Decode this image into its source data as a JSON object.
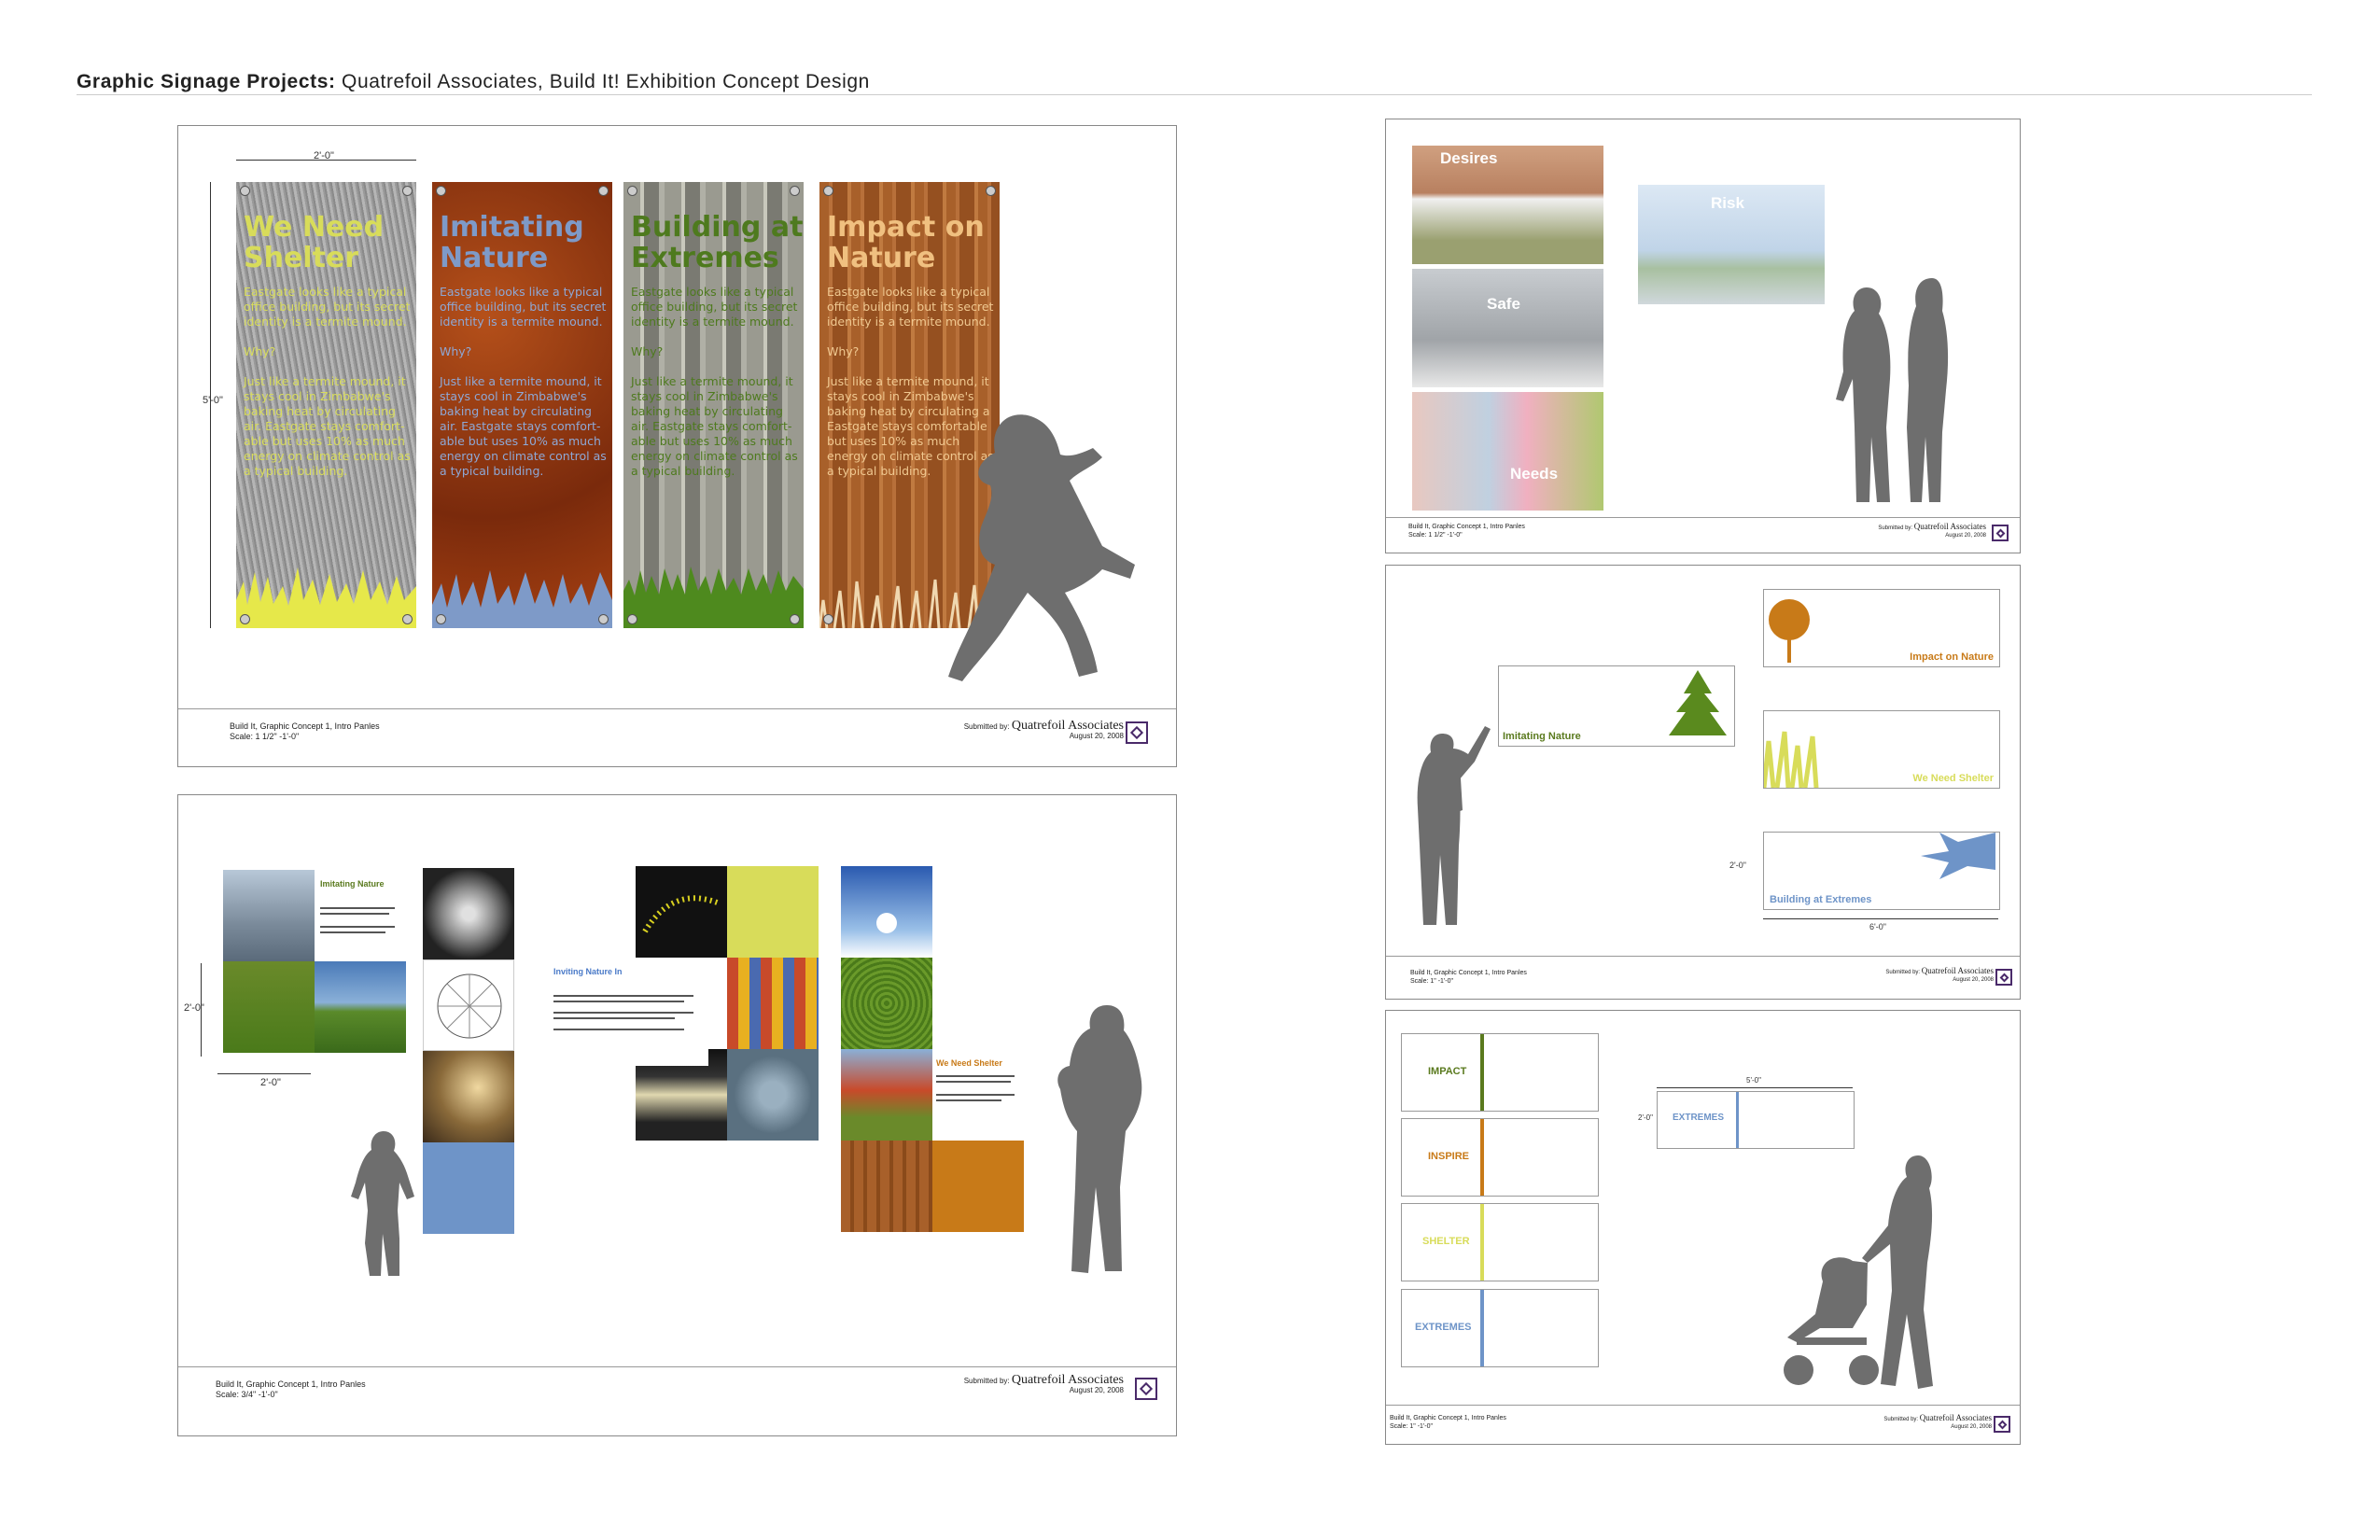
{
  "title": {
    "bold": "Graphic Signage Projects:",
    "rest": " Quatrefoil Associates, Build It! Exhibition Concept Design"
  },
  "colors": {
    "purple": "#4a2a6a",
    "green": "#5a7a1e",
    "orange": "#c87a18",
    "yellow_green": "#d8dc5a",
    "blue": "#6e94c8",
    "silhouette": "#6e6e6e"
  },
  "board1": {
    "dims": {
      "width": "2'-0\"",
      "height": "5'-0\""
    },
    "banners": [
      {
        "title": "We Need\nShelter",
        "color": "#d8dc5a",
        "body": "Eastgate looks like a typical\noffice building, but its secret\nidentity is a termite mound.\n\nWhy?\n\nJust like a termite mound, it\nstays cool in Zimbabwe's\nbaking heat by circulating\nair. Eastgate stays comfort-\nable but uses 10% as much\nenergy on climate control as\na typical building."
      },
      {
        "title": "Imitating\nNature",
        "color": "#7e9ac8",
        "body": "Eastgate looks like a typical\noffice building, but its secret\nidentity is a termite mound.\n\nWhy?\n\nJust like a termite mound, it\nstays cool in Zimbabwe's\nbaking heat by circulating\nair. Eastgate stays comfort-\nable but uses 10% as much\nenergy on climate control as\na typical building."
      },
      {
        "title": "Building at\nExtremes",
        "color": "#4e7a1e",
        "body": "Eastgate looks like a typical\noffice building, but its secret\nidentity is a termite mound.\n\nWhy?\n\nJust like a termite mound, it\nstays cool in Zimbabwe's\nbaking heat by circulating\nair. Eastgate stays comfort-\nable but uses 10% as much\nenergy on climate control as\na typical building."
      },
      {
        "title": "Impact on\nNature",
        "color": "#f0c080",
        "body": "Eastgate looks like a typical\noffice building, but its secret\nidentity is a termite mound.\n\nWhy?\n\nJust like a termite mound, it\nstays cool in Zimbabwe's\nbaking heat by circulating a\nEastgate stays comfortable\nbut uses 10% as much\nenergy on climate control as\na typical building."
      }
    ],
    "footer": {
      "line1": "Build It, Graphic Concept 1, Intro Panles",
      "line2": "Scale: 1 1/2\" -1'-0\"",
      "submitted": "Submitted by:",
      "company": "Quatrefoil Associates",
      "date": "August 20, 2008"
    }
  },
  "board2": {
    "dims": {
      "height": "2'-0\"",
      "width": "2'-0\""
    },
    "panel_a": {
      "title": "Imitating Nature"
    },
    "panel_b": {
      "title": "Inviting Nature In"
    },
    "panel_c": {
      "title": "We Need Shelter"
    },
    "footer": {
      "line1": "Build It, Graphic Concept 1, Intro Panles",
      "line2": "Scale: 3/4\" -1'-0\"",
      "submitted": "Submitted by:",
      "company": "Quatrefoil Associates",
      "date": "August 20, 2008"
    }
  },
  "board3": {
    "labels": {
      "desires": "Desires",
      "safe": "Safe",
      "needs": "Needs",
      "risk": "Risk"
    },
    "footer": {
      "line1": "Build It, Graphic Concept 1, Intro Panles",
      "line2": "Scale: 1 1/2\" -1'-0\"",
      "submitted": "Submitted by:",
      "company": "Quatrefoil Associates",
      "date": "August 20, 2008"
    }
  },
  "board4": {
    "signs": {
      "imitating": "Imitating Nature",
      "impact": "Impact on Nature",
      "shelter": "We Need Shelter",
      "extremes": "Building at Extremes"
    },
    "dims": {
      "height": "2'-0\"",
      "width": "6'-0\""
    },
    "footer": {
      "line1": "Build It, Graphic Concept 1, Intro Panles",
      "line2": "Scale: 1\" -1'-0\"",
      "submitted": "Submitted by:",
      "company": "Quatrefoil Associates",
      "date": "August 20, 2008"
    }
  },
  "board5": {
    "signs": {
      "impact": "IMPACT",
      "inspire": "INSPIRE",
      "shelter": "SHELTER",
      "extremes": "EXTREMES",
      "extremes_big": "EXTREMES"
    },
    "dims": {
      "width": "5'-0\"",
      "height": "2'-0\""
    },
    "footer": {
      "line1": "Build It, Graphic Concept 1, Intro Panles",
      "line2": "Scale: 1\" -1'-0\"",
      "submitted": "Submitted by:",
      "company": "Quatrefoil Associates",
      "date": "August 20, 2008"
    }
  }
}
